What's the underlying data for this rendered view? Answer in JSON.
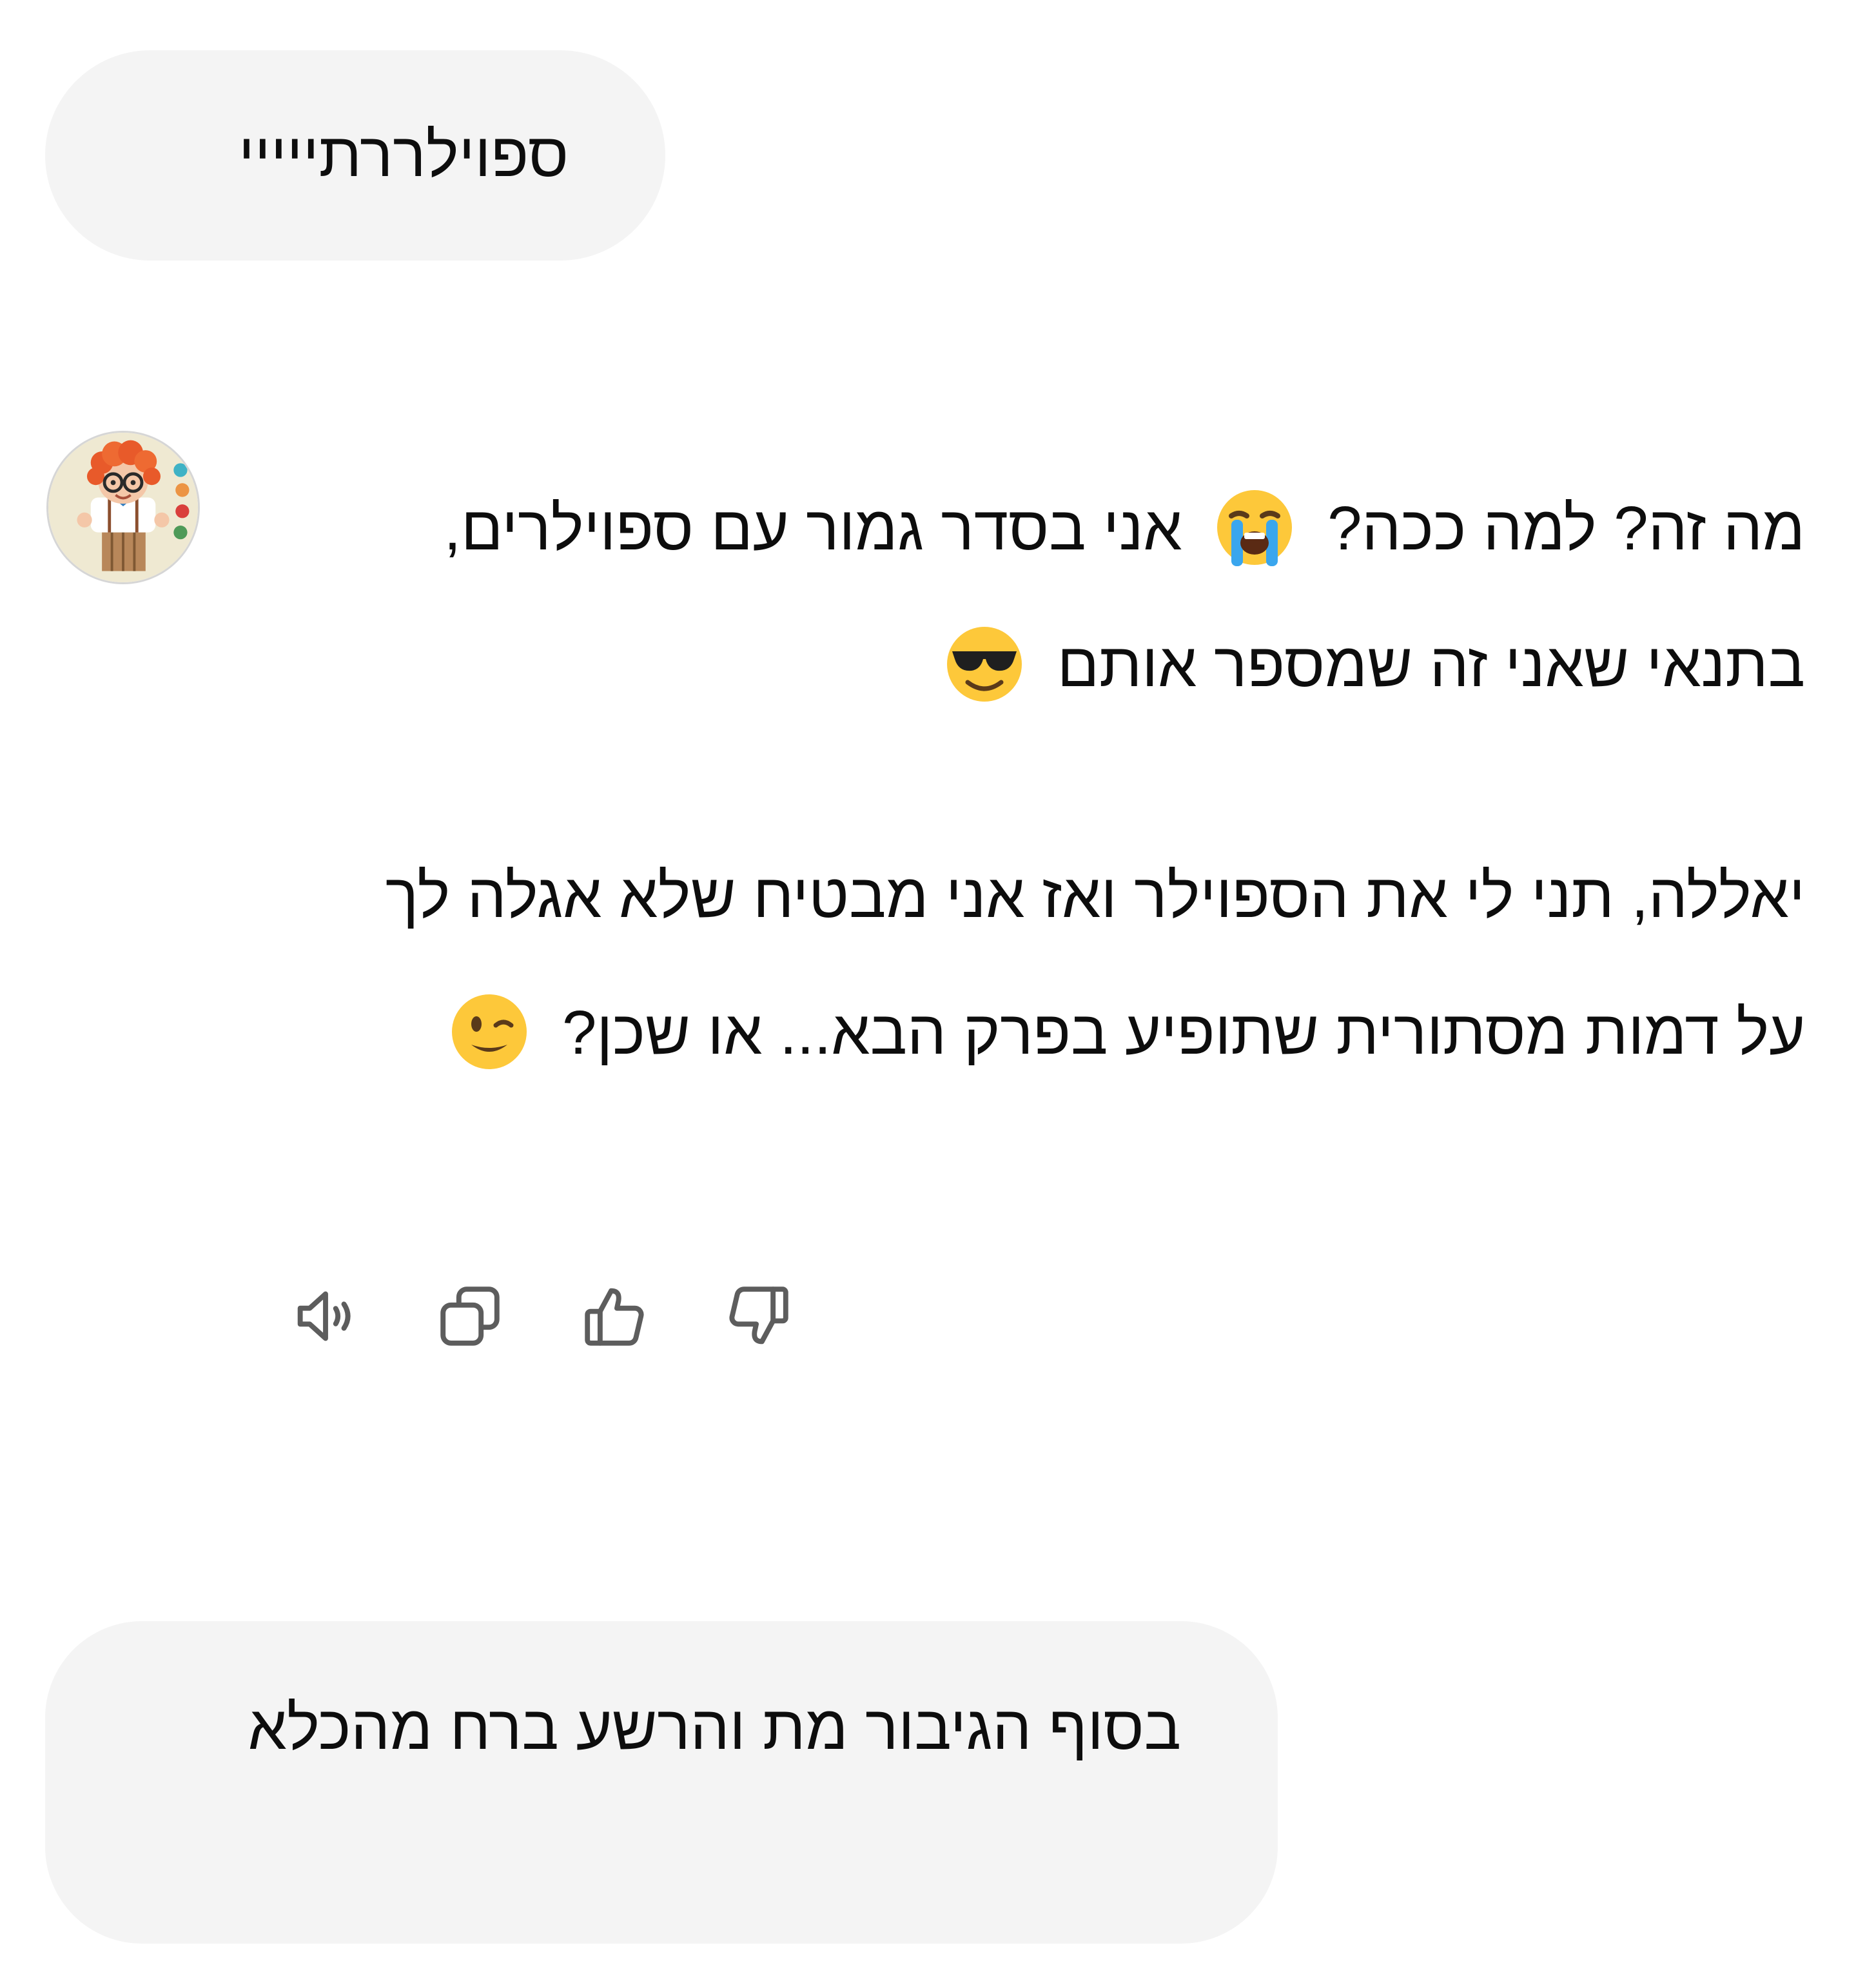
{
  "conversation": {
    "user_message_1": "ספוילררתייייי",
    "assistant_message": {
      "paragraph_1_text": "מה זה? למה ככה? 😭 אני בסדר גמור עם ספוילרים, בתנאי שאני זה שמספר אותם 😎",
      "paragraph_1": {
        "part_1": "מה זה? למה ככה?",
        "emoji_1": "loudly-crying-face",
        "part_2": "אני בסדר גמור עם ספוילרים, בתנאי שאני זה שמספר אותם",
        "emoji_2": "smiling-face-with-sunglasses"
      },
      "paragraph_2_text": "יאללה, תני לי את הספוילר ואז אני מבטיח שלא אגלה לך על דמות מסתורית שתופיע בפרק הבא... או שכן? 😉",
      "paragraph_2": {
        "part_1": "יאללה, תני לי את הספוילר ואז אני מבטיח שלא אגלה לך על דמות מסתורית שתופיע בפרק הבא... או שכן?",
        "emoji_1": "winking-face"
      }
    },
    "message_actions": [
      {
        "name": "read-aloud",
        "icon": "speaker-icon"
      },
      {
        "name": "copy",
        "icon": "copy-icon"
      },
      {
        "name": "good-response",
        "icon": "thumbs-up-icon"
      },
      {
        "name": "bad-response",
        "icon": "thumbs-down-icon"
      }
    ],
    "user_message_2": "בסוף הגיבור מת והרשע ברח מהכלא"
  },
  "colors": {
    "user_bubble_bg": "#f4f4f4",
    "text": "#0d0d0d",
    "icon": "#5d5d5d"
  }
}
